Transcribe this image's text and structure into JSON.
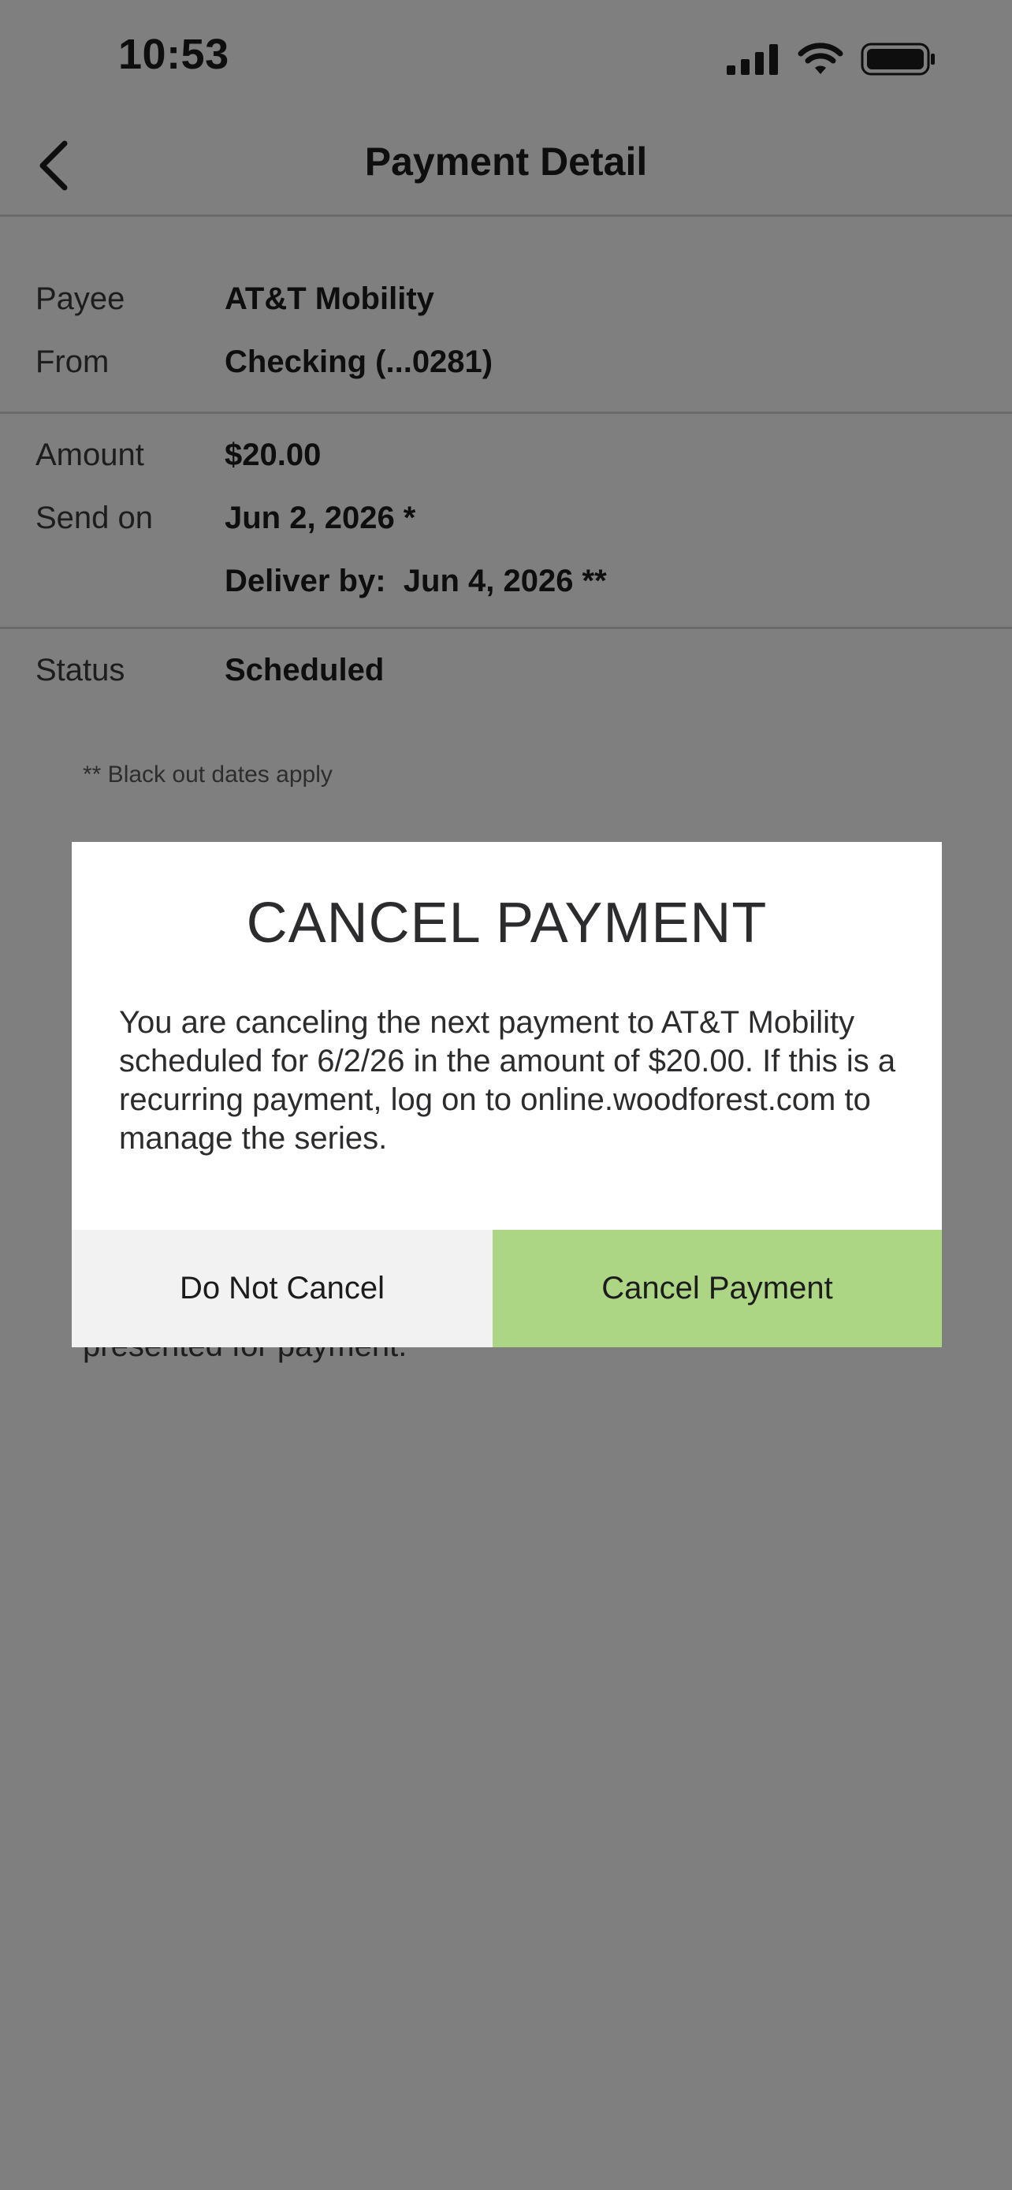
{
  "status_bar": {
    "time": "10:53"
  },
  "header": {
    "title": "Payment Detail"
  },
  "details": {
    "payee_label": "Payee",
    "payee_value": "AT&T Mobility",
    "from_label": "From",
    "from_value": "Checking (...0281)",
    "amount_label": "Amount",
    "amount_value": "$20.00",
    "send_on_label": "Send on",
    "send_on_value": "Jun 2, 2026 *",
    "deliver_by": "Deliver by:  Jun 4, 2026 **",
    "status_label": "Status",
    "status_value": "Scheduled"
  },
  "footnotes": {
    "blackout": "** Black out dates apply",
    "partial": "presented for payment."
  },
  "modal": {
    "title": "CANCEL PAYMENT",
    "message": "You are canceling the next payment to AT&T Mobility scheduled for 6/2/26 in the amount of $20.00. If this is a recurring payment, log on to online.woodforest.com to manage the series.",
    "do_not_cancel_label": "Do Not Cancel",
    "cancel_payment_label": "Cancel Payment"
  },
  "colors": {
    "accent": "#acd584",
    "secondary_button": "#f1f2f1",
    "overlay": "rgba(0,0,0,0.5)"
  },
  "icons": {
    "back": "chevron-left-icon",
    "signal": "cellular-signal-icon",
    "wifi": "wifi-icon",
    "battery": "battery-icon"
  }
}
